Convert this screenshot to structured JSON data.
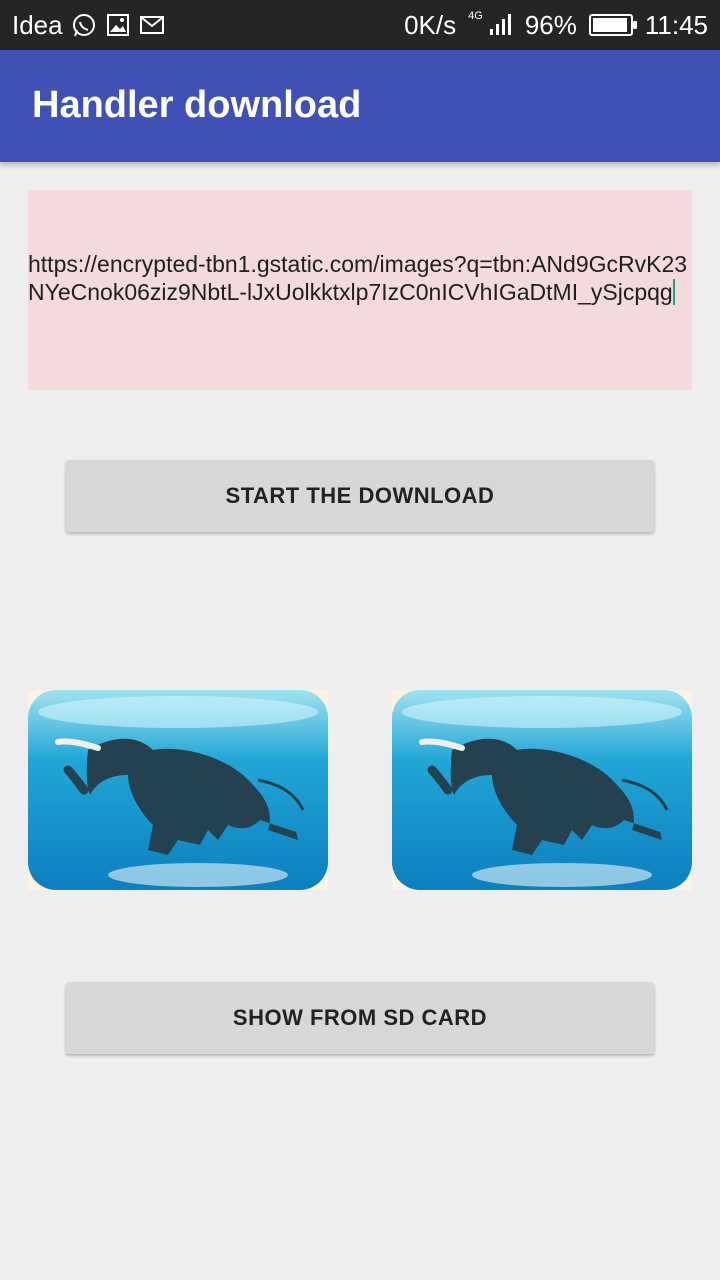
{
  "status_bar": {
    "carrier": "Idea",
    "speed": "0K/s",
    "network": "4G",
    "battery": "96%",
    "battery_level": 0.96,
    "time": "11:45",
    "icons": [
      "whatsapp-icon",
      "gallery-icon",
      "gmail-icon",
      "signal-icon",
      "battery-icon"
    ]
  },
  "app_bar": {
    "title": "Handler download",
    "color": "#3f51b5"
  },
  "url_input": {
    "value": "https://encrypted-tbn1.gstatic.com/images?q=tbn:ANd9GcRvK23NYeCnok06ziz9NbtL-lJxUolkktxlp7IzC0nICVhIGaDtMI_ySjcpqg",
    "background": "#f4dadd"
  },
  "buttons": {
    "start_download": "START THE DOWNLOAD",
    "show_sd": "SHOW FROM SD CARD"
  },
  "images": [
    {
      "subject": "swimming elephant underwater"
    },
    {
      "subject": "swimming elephant underwater"
    }
  ]
}
